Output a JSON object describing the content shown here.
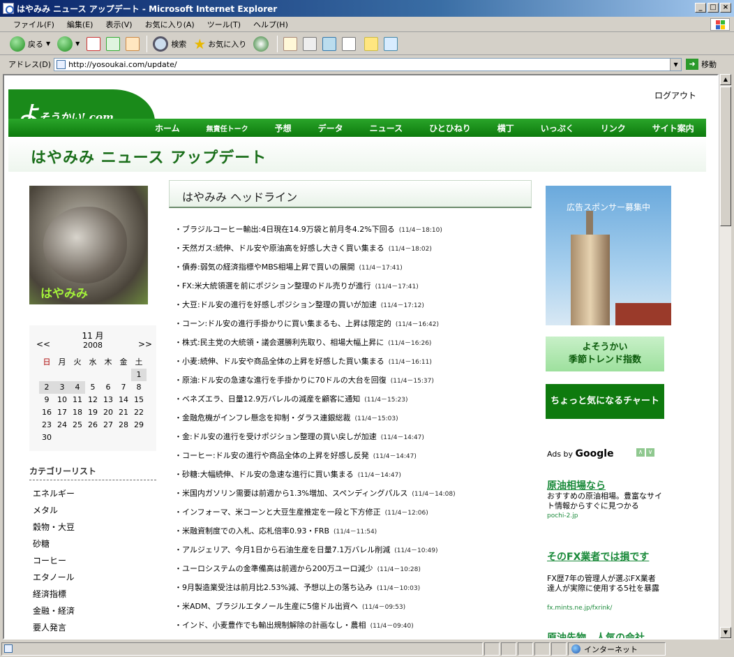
{
  "window": {
    "title": "はやみみ ニュース アップデート - Microsoft Internet Explorer",
    "btn_min": "_",
    "btn_max": "□",
    "btn_close": "×"
  },
  "menu": [
    "ファイル(F)",
    "編集(E)",
    "表示(V)",
    "お気に入り(A)",
    "ツール(T)",
    "ヘルプ(H)"
  ],
  "toolbar": {
    "back": "戻る",
    "search": "検索",
    "favorites": "お気に入り"
  },
  "address": {
    "label": "アドレス(D)",
    "url": "http://yosoukai.com/update/",
    "go": "移動"
  },
  "status": {
    "zone": "インターネット"
  },
  "site": {
    "logout": "ログアウト",
    "logo_main": "よ",
    "logo_sub": "そうかい!.com",
    "nav": [
      "ホーム",
      "無責任トーク",
      "予想",
      "データ",
      "ニュース",
      "ひとひねり",
      "横丁",
      "いっぷく",
      "リンク",
      "サイト案内"
    ],
    "page_title": "はやみみ ニュース アップデート"
  },
  "photo_label": "はやみみ",
  "calendar": {
    "month": "11 月",
    "year": "2008",
    "prev": "<<",
    "next": ">>",
    "weekdays": [
      "日",
      "月",
      "火",
      "水",
      "木",
      "金",
      "土"
    ],
    "days": [
      "1",
      "2",
      "3",
      "4",
      "5",
      "6",
      "7",
      "8",
      "9",
      "10",
      "11",
      "12",
      "13",
      "14",
      "15",
      "16",
      "17",
      "18",
      "19",
      "20",
      "21",
      "22",
      "23",
      "24",
      "25",
      "26",
      "27",
      "28",
      "29",
      "30"
    ],
    "highlighted": [
      "1",
      "2",
      "3",
      "4"
    ],
    "colors": {
      "sunday": "#aa0000",
      "saturday": "#000000"
    }
  },
  "categories": {
    "title": "カテゴリーリスト",
    "items": [
      "エネルギー",
      "メタル",
      "穀物・大豆",
      "砂糖",
      "コーヒー",
      "エタノール",
      "経済指標",
      "金融・経済",
      "要人発言"
    ]
  },
  "headline_title": "はやみみ ヘッドライン",
  "news": [
    {
      "text": "ブラジルコーヒー輸出:4日現在14.9万袋と前月冬4.2%下回る",
      "ts": "(11/4－18:10)"
    },
    {
      "text": "天然ガス:続伸、ドル安や原油高を好感し大きく買い集まる",
      "ts": "(11/4－18:02)"
    },
    {
      "text": "債券:弱気の経済指標やMBS相場上昇で買いの展開",
      "ts": "(11/4－17:41)"
    },
    {
      "text": "FX:米大統領選を前にポジション整理のドル売りが進行",
      "ts": "(11/4－17:41)"
    },
    {
      "text": "大豆:ドル安の進行を好感しポジション整理の買いが加速",
      "ts": "(11/4－17:12)"
    },
    {
      "text": "コーン:ドル安の進行手掛かりに買い集まるも、上昇は限定的",
      "ts": "(11/4－16:42)"
    },
    {
      "text": "株式:民主党の大統領・議会選勝利先取り、相場大幅上昇に",
      "ts": "(11/4－16:26)"
    },
    {
      "text": "小麦:続伸、ドル安や商品全体の上昇を好感した買い集まる",
      "ts": "(11/4－16:11)"
    },
    {
      "text": "原油:ドル安の急速な進行を手掛かりに70ドルの大台を回復",
      "ts": "(11/4－15:37)"
    },
    {
      "text": "ベネズエラ、日量12.9万バレルの減産を顧客に通知",
      "ts": "(11/4－15:23)"
    },
    {
      "text": "金融危機がインフレ懸念を抑制・ダラス連銀総裁",
      "ts": "(11/4－15:03)"
    },
    {
      "text": "金:ドル安の進行を受けポジション整理の買い戻しが加速",
      "ts": "(11/4－14:47)"
    },
    {
      "text": "コーヒー:ドル安の進行や商品全体の上昇を好感し反発",
      "ts": "(11/4－14:47)"
    },
    {
      "text": "砂糖:大幅続伸、ドル安の急速な進行に買い集まる",
      "ts": "(11/4－14:47)"
    },
    {
      "text": "米国内ガソリン需要は前週から1.3%増加、スペンディングパルス",
      "ts": "(11/4－14:08)"
    },
    {
      "text": "インフォーマ、米コーンと大豆生産推定を一段と下方修正",
      "ts": "(11/4－12:06)"
    },
    {
      "text": "米融資制度での入札、応札倍率0.93・FRB",
      "ts": "(11/4－11:54)"
    },
    {
      "text": "アルジェリア、今月1日から石油生産を日量7.1万バレル削減",
      "ts": "(11/4－10:49)"
    },
    {
      "text": "ユーロシステムの金準備高は前週から200万ユーロ減少",
      "ts": "(11/4－10:28)"
    },
    {
      "text": "9月製造業受注は前月比2.53%減、予想以上の落ち込み",
      "ts": "(11/4－10:03)"
    },
    {
      "text": "米ADM、ブラジルエタノール生産に5億ドル出資へ",
      "ts": "(11/4－09:53)"
    },
    {
      "text": "インド、小麦豊作でも輸出規制解除の計画なし・農相",
      "ts": "(11/4－09:40)"
    }
  ],
  "ads": {
    "sponsor": "広告スポンサー募集中",
    "trend_line1": "よそうかい",
    "trend_line2": "季節トレンド指数",
    "chart": "ちょっと気になるチャート",
    "adsby_prefix": "Ads by ",
    "adsby_brand": "Google",
    "google": [
      {
        "title": "原油相場なら",
        "desc": "おすすめの原油相場。豊富なサイト情報からすぐに見つかる",
        "url": "pochi-2.jp"
      },
      {
        "title": "そのFX業者では損です",
        "desc": "FX歴7年の管理人が選ぶFX業者 達人が実際に使用する5社を暴露",
        "url": "fx.mints.ne.jp/fxrink/"
      },
      {
        "title": "原油先物、人気の会社",
        "desc": "",
        "url": ""
      }
    ]
  }
}
